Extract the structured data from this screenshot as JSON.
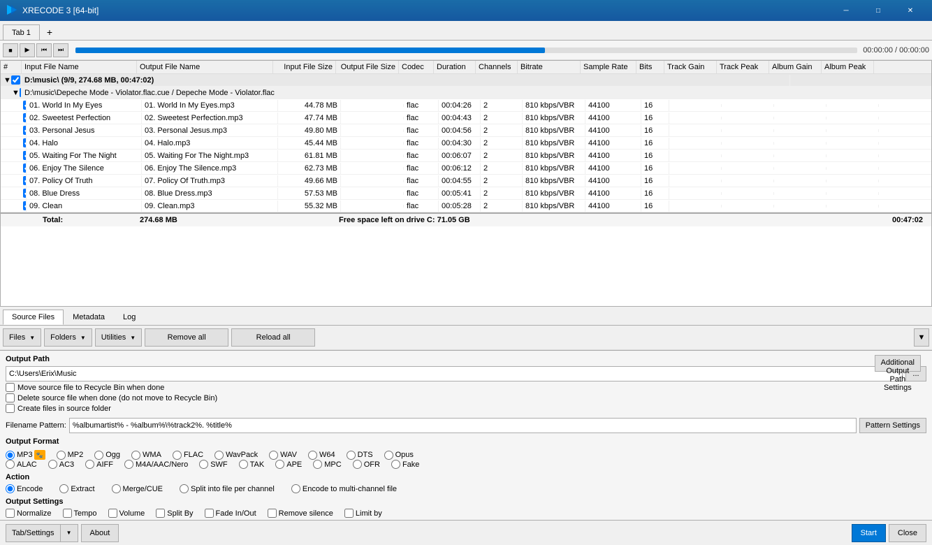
{
  "titlebar": {
    "title": "XRECODE 3 [64-bit]",
    "icon": "▶"
  },
  "tabs": [
    {
      "label": "Tab 1",
      "active": true
    },
    {
      "label": "+",
      "is_add": true
    }
  ],
  "transport": {
    "time_display": "00:00:00 / 00:00:00"
  },
  "columns": [
    {
      "label": "#"
    },
    {
      "label": "Input File Name"
    },
    {
      "label": "Output File Name"
    },
    {
      "label": "Input File Size"
    },
    {
      "label": "Output File Size"
    },
    {
      "label": "Codec"
    },
    {
      "label": "Duration"
    },
    {
      "label": "Channels"
    },
    {
      "label": "Bitrate"
    },
    {
      "label": "Sample Rate"
    },
    {
      "label": "Bits"
    },
    {
      "label": "Track Gain"
    },
    {
      "label": "Track Peak"
    },
    {
      "label": "Album Gain"
    },
    {
      "label": "Album Peak"
    }
  ],
  "groups": [
    {
      "label": "D:\\music\\ (9/9, 274.68 MB, 00:47:02)",
      "checked": true,
      "expanded": true,
      "subgroups": [
        {
          "label": "D:\\music\\Depeche Mode - Violator.flac.cue / Depeche Mode - Violator.flac",
          "checked": true,
          "expanded": true,
          "tracks": [
            {
              "num": 1,
              "input": "01. World In My Eyes",
              "output": "01. World In My Eyes.mp3",
              "input_size": "44.78 MB",
              "output_size": "",
              "codec": "flac",
              "duration": "00:04:26",
              "channels": "2",
              "bitrate": "810 kbps/VBR",
              "samplerate": "44100",
              "bits": "16",
              "checked": true
            },
            {
              "num": 2,
              "input": "02. Sweetest Perfection",
              "output": "02. Sweetest Perfection.mp3",
              "input_size": "47.74 MB",
              "output_size": "",
              "codec": "flac",
              "duration": "00:04:43",
              "channels": "2",
              "bitrate": "810 kbps/VBR",
              "samplerate": "44100",
              "bits": "16",
              "checked": true
            },
            {
              "num": 3,
              "input": "03. Personal Jesus",
              "output": "03. Personal Jesus.mp3",
              "input_size": "49.80 MB",
              "output_size": "",
              "codec": "flac",
              "duration": "00:04:56",
              "channels": "2",
              "bitrate": "810 kbps/VBR",
              "samplerate": "44100",
              "bits": "16",
              "checked": true
            },
            {
              "num": 4,
              "input": "04. Halo",
              "output": "04. Halo.mp3",
              "input_size": "45.44 MB",
              "output_size": "",
              "codec": "flac",
              "duration": "00:04:30",
              "channels": "2",
              "bitrate": "810 kbps/VBR",
              "samplerate": "44100",
              "bits": "16",
              "checked": true
            },
            {
              "num": 5,
              "input": "05. Waiting For The Night",
              "output": "05. Waiting For The Night.mp3",
              "input_size": "61.81 MB",
              "output_size": "",
              "codec": "flac",
              "duration": "00:06:07",
              "channels": "2",
              "bitrate": "810 kbps/VBR",
              "samplerate": "44100",
              "bits": "16",
              "checked": true
            },
            {
              "num": 6,
              "input": "06. Enjoy The Silence",
              "output": "06. Enjoy The Silence.mp3",
              "input_size": "62.73 MB",
              "output_size": "",
              "codec": "flac",
              "duration": "00:06:12",
              "channels": "2",
              "bitrate": "810 kbps/VBR",
              "samplerate": "44100",
              "bits": "16",
              "checked": true
            },
            {
              "num": 7,
              "input": "07. Policy Of Truth",
              "output": "07. Policy Of Truth.mp3",
              "input_size": "49.66 MB",
              "output_size": "",
              "codec": "flac",
              "duration": "00:04:55",
              "channels": "2",
              "bitrate": "810 kbps/VBR",
              "samplerate": "44100",
              "bits": "16",
              "checked": true
            },
            {
              "num": 8,
              "input": "08. Blue Dress",
              "output": "08. Blue Dress.mp3",
              "input_size": "57.53 MB",
              "output_size": "",
              "codec": "flac",
              "duration": "00:05:41",
              "channels": "2",
              "bitrate": "810 kbps/VBR",
              "samplerate": "44100",
              "bits": "16",
              "checked": true
            },
            {
              "num": 9,
              "input": "09. Clean",
              "output": "09. Clean.mp3",
              "input_size": "55.32 MB",
              "output_size": "",
              "codec": "flac",
              "duration": "00:05:28",
              "channels": "2",
              "bitrate": "810 kbps/VBR",
              "samplerate": "44100",
              "bits": "16",
              "checked": true
            }
          ]
        }
      ]
    }
  ],
  "total": {
    "label": "Total:",
    "size": "274.68 MB",
    "free_space": "Free space left on drive C: 71.05 GB",
    "duration": "00:47:02"
  },
  "bottom_tabs": [
    {
      "label": "Source Files",
      "active": true
    },
    {
      "label": "Metadata"
    },
    {
      "label": "Log"
    }
  ],
  "toolbar": {
    "files_label": "Files",
    "folders_label": "Folders",
    "utilities_label": "Utilities",
    "remove_all_label": "Remove all",
    "reload_all_label": "Reload all"
  },
  "output_path": {
    "section_label": "Output Path",
    "path_value": "C:\\Users\\Erix\\Music",
    "move_to_recycle": "Move source file to Recycle Bin when done",
    "delete_source": "Delete source file when done (do not move to Recycle Bin)",
    "create_in_source": "Create files in source folder",
    "additional_btn_label": "Additional Output Path Settings"
  },
  "filename_pattern": {
    "label": "Filename Pattern:",
    "value": "%albumartist% - %album%\\%track2%. %title%",
    "settings_btn": "Pattern Settings"
  },
  "output_format": {
    "section_label": "Output Format",
    "formats": [
      {
        "label": "MP3",
        "checked": true,
        "has_icon": true
      },
      {
        "label": "MP2",
        "checked": false
      },
      {
        "label": "Ogg",
        "checked": false
      },
      {
        "label": "WMA",
        "checked": false
      },
      {
        "label": "FLAC",
        "checked": false
      },
      {
        "label": "WavPack",
        "checked": false
      },
      {
        "label": "WAV",
        "checked": false
      },
      {
        "label": "W64",
        "checked": false
      },
      {
        "label": "DTS",
        "checked": false
      },
      {
        "label": "Opus",
        "checked": false
      },
      {
        "label": "ALAC",
        "checked": false
      },
      {
        "label": "AC3",
        "checked": false
      },
      {
        "label": "AIFF",
        "checked": false
      },
      {
        "label": "M4A/AAC/Nero",
        "checked": false
      },
      {
        "label": "SWF",
        "checked": false
      },
      {
        "label": "TAK",
        "checked": false
      },
      {
        "label": "APE",
        "checked": false
      },
      {
        "label": "MPC",
        "checked": false
      },
      {
        "label": "OFR",
        "checked": false
      },
      {
        "label": "Fake",
        "checked": false
      }
    ]
  },
  "action": {
    "section_label": "Action",
    "actions": [
      {
        "label": "Encode",
        "checked": true
      },
      {
        "label": "Extract",
        "checked": false
      },
      {
        "label": "Merge/CUE",
        "checked": false
      },
      {
        "label": "Split into file per channel",
        "checked": false
      },
      {
        "label": "Encode to multi-channel file",
        "checked": false
      }
    ]
  },
  "output_settings": {
    "section_label": "Output Settings",
    "settings": [
      {
        "label": "Normalize",
        "checked": false
      },
      {
        "label": "Tempo",
        "checked": false
      },
      {
        "label": "Volume",
        "checked": false
      },
      {
        "label": "Split By",
        "checked": false
      },
      {
        "label": "Fade In/Out",
        "checked": false
      },
      {
        "label": "Remove silence",
        "checked": false
      },
      {
        "label": "Limit by",
        "checked": false
      }
    ]
  },
  "bottom_bar": {
    "tab_settings_label": "Tab/Settings",
    "about_label": "About",
    "start_label": "Start",
    "close_label": "Close"
  }
}
